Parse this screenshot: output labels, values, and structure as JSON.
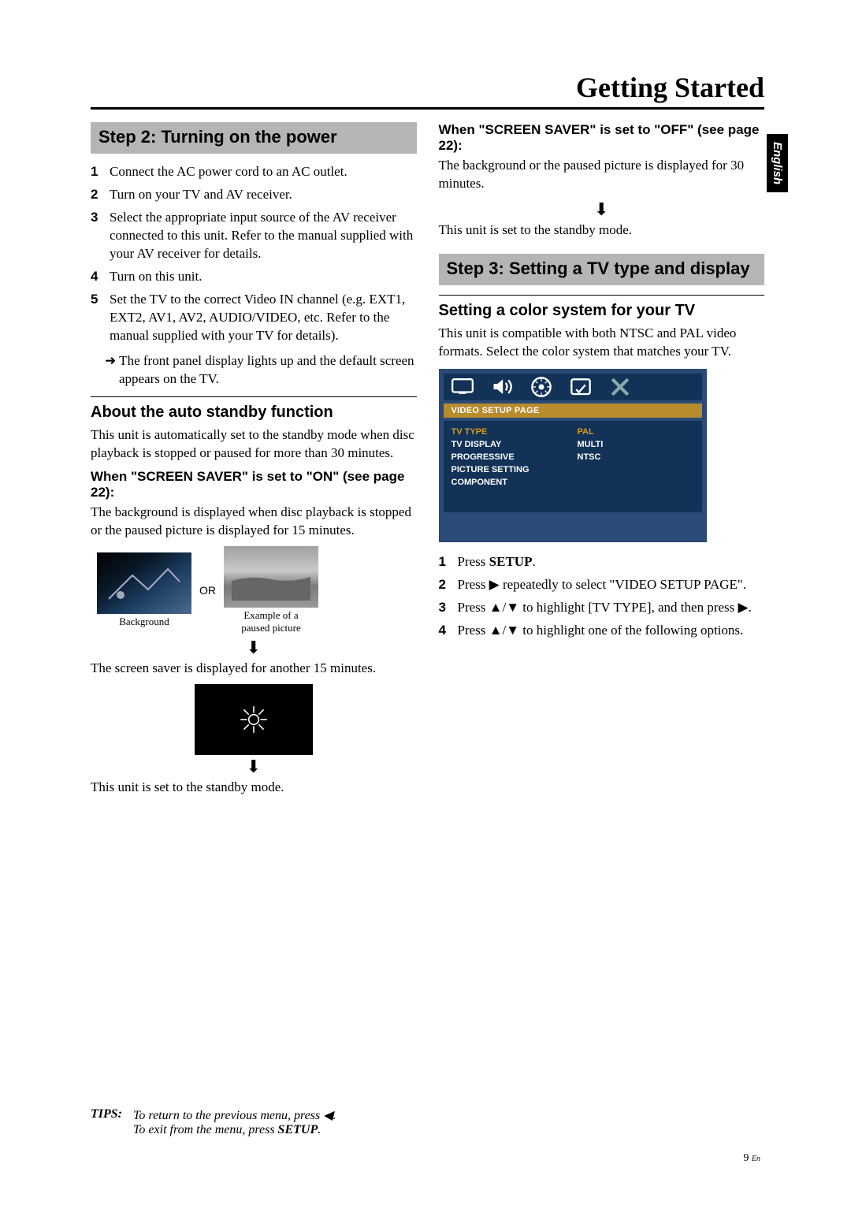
{
  "title": "Getting Started",
  "language_tab": "English",
  "left": {
    "step_heading": "Step 2: Turning on the power",
    "items": [
      "Connect the AC power cord to an AC outlet.",
      "Turn on your TV and AV receiver.",
      "Select the appropriate input source of the AV receiver connected to this unit. Refer to the manual supplied with your AV receiver for details.",
      "Turn on this unit.",
      "Set the TV to the correct Video IN channel (e.g. EXT1, EXT2, AV1, AV2, AUDIO/VIDEO, etc. Refer to the manual supplied with your TV for details)."
    ],
    "arrow_note": "➜ The front panel display lights up and the default screen appears on the TV.",
    "sub1": "About the auto standby function",
    "sub1_para": "This unit is automatically set to the standby mode when disc playback is stopped or paused for more than 30 minutes.",
    "ss_on_head": "When \"SCREEN SAVER\" is set to \"ON\" (see page 22):",
    "ss_on_body": "The background is displayed when disc playback is stopped or the paused picture is displayed for 15 minutes.",
    "background_label": "Background",
    "or_label": "OR",
    "paused_label": "Example of a\npaused picture",
    "saver_para": "The screen saver is displayed for another 15 minutes.",
    "standby_para": "This unit is set to the standby mode."
  },
  "right": {
    "ss_off_head": "When \"SCREEN SAVER\" is set to \"OFF\" (see page 22):",
    "ss_off_body": "The background or the paused picture is displayed for 30 minutes.",
    "standby_para": "This unit is set to the standby mode.",
    "step_heading": "Step 3: Setting a TV type and display",
    "sub1": "Setting a color system for your TV",
    "sub1_para": "This unit is compatible with both NTSC and PAL video formats. Select the color system that matches your TV.",
    "osd": {
      "title": "VIDEO SETUP PAGE",
      "rows_left": [
        "TV TYPE",
        "TV DISPLAY",
        "PROGRESSIVE",
        "PICTURE SETTING",
        "COMPONENT"
      ],
      "rows_right": [
        "PAL",
        "MULTI",
        "NTSC"
      ]
    },
    "items": [
      "Press SETUP.",
      "Press ▶ repeatedly to select \"VIDEO SETUP PAGE\".",
      "Press ▲/▼ to highlight [TV TYPE], and then press ▶.",
      "Press ▲/▼ to highlight one of the following options."
    ]
  },
  "tips": {
    "label": "TIPS:",
    "line1": "To return to the previous menu, press ◀.",
    "line2": "To exit from the menu, press SETUP."
  },
  "page_number": "9",
  "page_lang": "En"
}
